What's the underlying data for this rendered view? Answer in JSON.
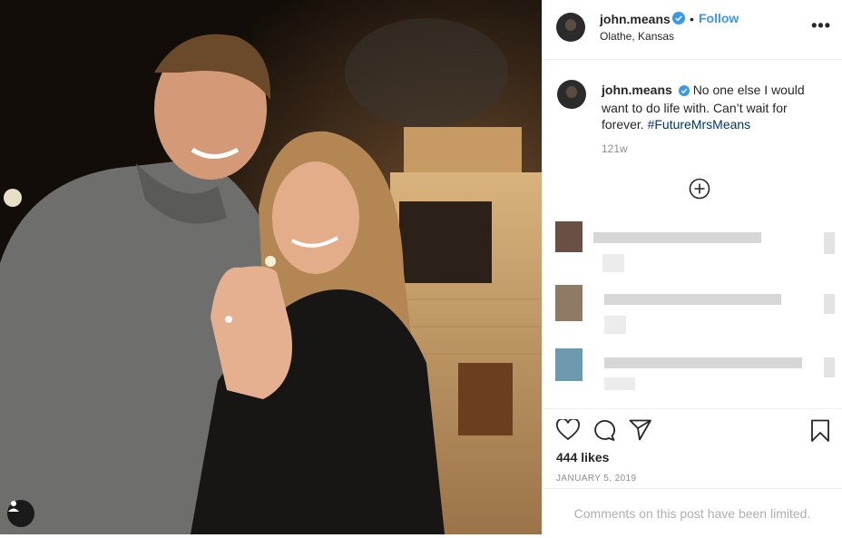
{
  "post": {
    "username": "john.means",
    "follow_label": "Follow",
    "separator": "•",
    "location": "Olathe, Kansas",
    "more_label": "•••",
    "caption_text": "No one else I would want to do life with. Can’t wait for forever.",
    "hashtag": "#FutureMrsMeans",
    "age": "121w",
    "likes": "444 likes",
    "date": "JANUARY 5, 2019",
    "comments_limited": "Comments on this post have been limited."
  },
  "icons": {
    "verified": "verified-badge-icon",
    "more": "more-options-icon",
    "load_comments": "plus-circle-icon",
    "like": "heart-icon",
    "comment": "comment-bubble-icon",
    "share": "paper-plane-icon",
    "save": "bookmark-icon",
    "user_tag": "user-tag-icon"
  },
  "colors": {
    "link": "#3897f0",
    "hashtag": "#003569",
    "verified": "#3897f0",
    "muted": "#8e8e8e",
    "divider": "#efefef"
  },
  "blurred_comments_count": 3
}
